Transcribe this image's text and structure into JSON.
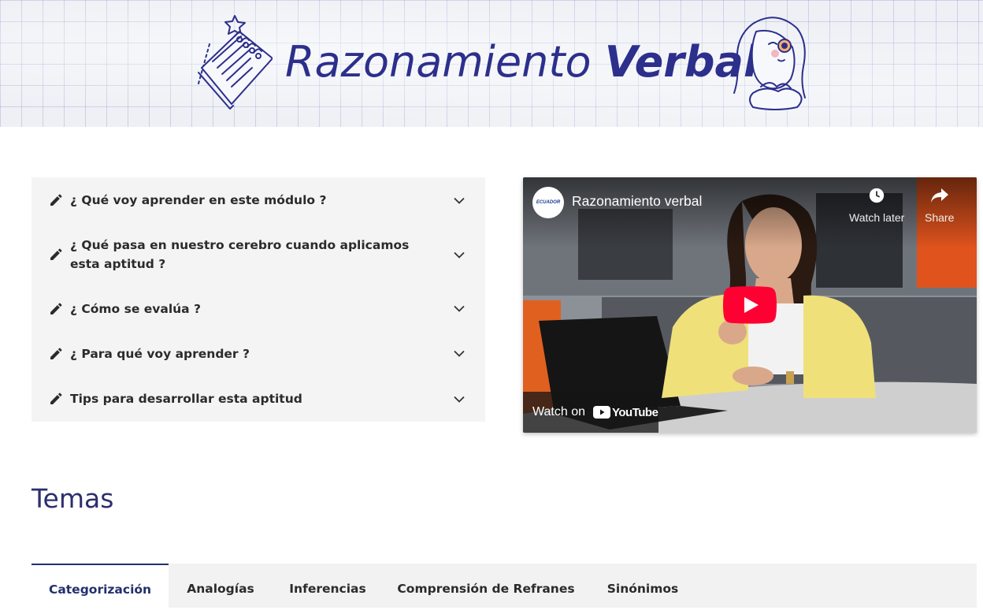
{
  "banner": {
    "title_light": "Razonamiento ",
    "title_bold": "Verbal"
  },
  "accordion": {
    "items": [
      {
        "label": "¿ Qué voy aprender en este módulo ?",
        "icon": "pencil-icon"
      },
      {
        "label": "¿ Qué pasa en nuestro cerebro cuando aplicamos esta aptitud ?",
        "icon": "pencil-icon"
      },
      {
        "label": "¿ Cómo se evalúa ?",
        "icon": "pencil-icon"
      },
      {
        "label": "¿ Para qué voy aprender ?",
        "icon": "pencil-icon"
      },
      {
        "label": "Tips para desarrollar esta aptitud",
        "icon": "pencil-icon"
      }
    ]
  },
  "video": {
    "title": "Razonamiento verbal",
    "watch_later": "Watch later",
    "share": "Share",
    "watch_on": "Watch on",
    "youtube": "YouTube",
    "channel_avatar_text": "ECUADOR"
  },
  "section": {
    "heading": "Temas"
  },
  "tabs": {
    "items": [
      "Categorización",
      "Analogías",
      "Inferencias",
      "Comprensión de Refranes",
      "Sinónimos"
    ],
    "active": "Categorización"
  },
  "colors": {
    "brand": "#2d2f8c",
    "tab_active": "#22306e",
    "youtube_red": "#ff0033"
  }
}
